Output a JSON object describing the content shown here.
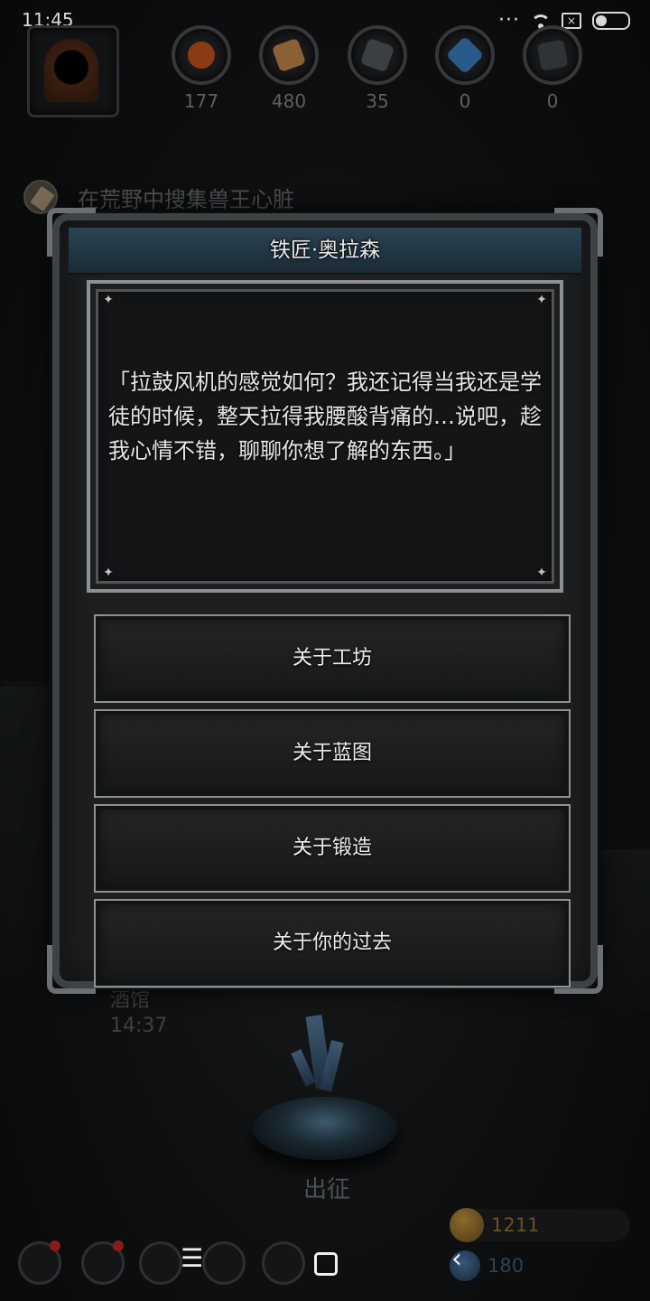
{
  "status_bar": {
    "time": "11:45",
    "more": "···",
    "notification_icon": "x-box-icon"
  },
  "hud": {
    "resources": [
      {
        "icon": "meat-icon",
        "count": "177",
        "color": "#8a3b16"
      },
      {
        "icon": "wood-icon",
        "count": "480",
        "color": "#8a6034"
      },
      {
        "icon": "iron-icon",
        "count": "35",
        "color": "#3b3f42"
      },
      {
        "icon": "crystal-icon",
        "count": "0",
        "color": "#2a5a8a"
      },
      {
        "icon": "ingot-icon",
        "count": "0",
        "color": "#2f3336"
      }
    ]
  },
  "quest": {
    "text": "在荒野中搜集兽王心脏"
  },
  "dialog": {
    "title": "铁匠·奥拉森",
    "body": "「拉鼓风机的感觉如何？我还记得当我还是学徒的时候，整天拉得我腰酸背痛的…说吧，趁我心情不错，聊聊你想了解的东西。」",
    "options": [
      "关于工坊",
      "关于蓝图",
      "关于锻造",
      "关于你的过去"
    ]
  },
  "scene": {
    "tavern_label": "酒馆",
    "tavern_time": "14:37",
    "march_label": "出征"
  },
  "currency": {
    "gold": "1211",
    "gems": "180"
  },
  "nav": {
    "menu": "☰",
    "back": "‹"
  }
}
